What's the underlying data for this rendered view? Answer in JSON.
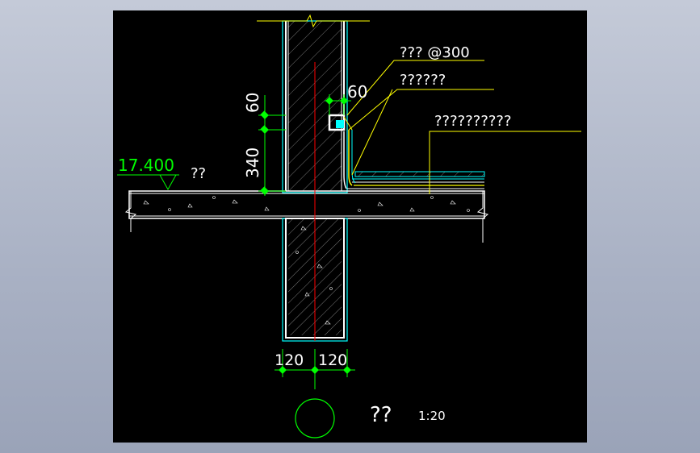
{
  "drawing": {
    "labels": {
      "nail_spacing": "??? @300",
      "flashing_note": "??????",
      "roof_layers_note": "??????????",
      "elevation": "17.400",
      "elevation_suffix": "??",
      "dim_60_top": "60",
      "dim_60_left": "60",
      "dim_340": "340",
      "dim_120_left": "120",
      "dim_120_right": "120",
      "detail_title": "??",
      "scale": "1:20"
    },
    "colors": {
      "background": "#000000",
      "frame_bg": "#a9b1c4",
      "wall_outline": "#00ffff",
      "plaster": "#ffffff",
      "dimension": "#00ff00",
      "leader": "#ffff00",
      "axis": "#ff0000",
      "text": "#ffffff",
      "waterproof": "#ffff00",
      "roof_layer": "#00ffff"
    }
  }
}
